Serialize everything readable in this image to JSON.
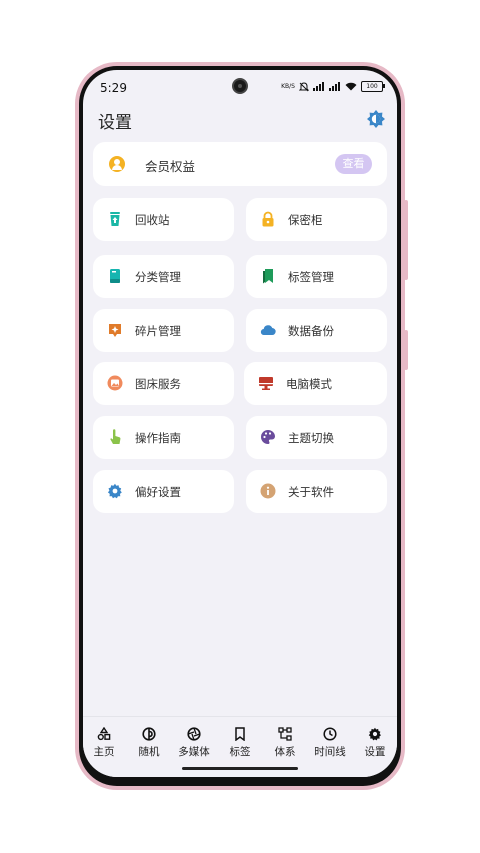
{
  "status": {
    "time": "5:29",
    "network_speed": "KB/S",
    "battery": "100"
  },
  "page": {
    "title": "设置"
  },
  "member": {
    "label": "会员权益",
    "button": "查看"
  },
  "tiles": [
    {
      "label": "回收站",
      "icon": "recycle-bin-icon",
      "color": "#1bb7a6"
    },
    {
      "label": "保密柜",
      "icon": "lock-icon",
      "color": "#f4b223"
    },
    {
      "label": "分类管理",
      "icon": "book-icon",
      "color": "#16b5b0"
    },
    {
      "label": "标签管理",
      "icon": "bookmark-icon",
      "color": "#1e9b5a"
    },
    {
      "label": "碎片管理",
      "icon": "sparkle-note-icon",
      "color": "#e07b2a"
    },
    {
      "label": "数据备份",
      "icon": "cloud-icon",
      "color": "#3a86c8"
    },
    {
      "label": "图床服务",
      "icon": "image-icon",
      "color": "#f08a5d"
    },
    {
      "label": "电脑模式",
      "icon": "monitor-icon",
      "color": "#c0392b"
    },
    {
      "label": "操作指南",
      "icon": "hand-pointer-icon",
      "color": "#8bc34a"
    },
    {
      "label": "主题切换",
      "icon": "palette-icon",
      "color": "#6a4c9c"
    },
    {
      "label": "偏好设置",
      "icon": "gear-icon",
      "color": "#3a86c8"
    },
    {
      "label": "关于软件",
      "icon": "info-icon",
      "color": "#d4a373"
    }
  ],
  "tabs": [
    {
      "label": "主页",
      "icon": "shapes-icon"
    },
    {
      "label": "随机",
      "icon": "random-icon"
    },
    {
      "label": "多媒体",
      "icon": "aperture-icon"
    },
    {
      "label": "标签",
      "icon": "bookmark-icon"
    },
    {
      "label": "体系",
      "icon": "hierarchy-icon"
    },
    {
      "label": "时间线",
      "icon": "clock-icon"
    },
    {
      "label": "设置",
      "icon": "gear-icon"
    }
  ],
  "colors": {
    "accent": "#3a86c8",
    "background": "#f2f1f7",
    "view_button": "#d4c6f2"
  }
}
